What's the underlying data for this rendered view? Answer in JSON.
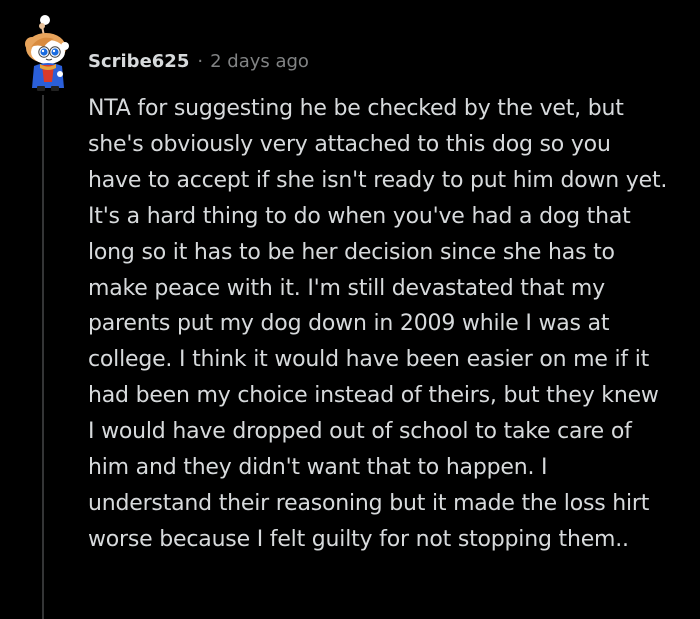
{
  "comment": {
    "author": "Scribe625",
    "separator": "·",
    "timestamp": "2 days ago",
    "body": "NTA for suggesting he be checked by the vet, but she's obviously very attached to this dog so you have to accept if she isn't ready to put him down yet. It's a hard thing to do when you've had a dog that long so it has to be her decision since she has to make peace with it. I'm still devastated that my parents put my dog down in 2009 while I was at college. I think it would have been easier on me if it had been my choice instead of theirs, but they knew I would have dropped out of school to take care of him and they didn't want that to happen. I understand their reasoning but it made the loss hirt worse because I felt guilty for not stopping them..",
    "avatar_icon": "snoo-avatar-icon",
    "online_dot_icon": "online-indicator-icon"
  },
  "colors": {
    "background": "#000000",
    "text": "#d7dadc",
    "meta_text": "#818384",
    "thread_line": "#343536"
  }
}
